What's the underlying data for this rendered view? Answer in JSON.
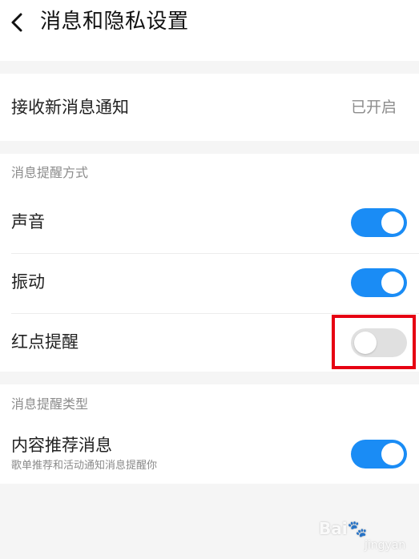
{
  "header": {
    "title": "消息和隐私设置",
    "back_icon": "chevron-left-icon"
  },
  "notification": {
    "label": "接收新消息通知",
    "value": "已开启"
  },
  "reminder_section": {
    "title": "消息提醒方式",
    "items": [
      {
        "label": "声音",
        "enabled": true
      },
      {
        "label": "振动",
        "enabled": true
      },
      {
        "label": "红点提醒",
        "enabled": false
      }
    ]
  },
  "type_section": {
    "title": "消息提醒类型",
    "items": [
      {
        "label": "内容推荐消息",
        "sublabel": "歌单推荐和活动通知消息提醒你",
        "enabled": true
      }
    ]
  },
  "highlight_color": "#e60012",
  "toggle_on_color": "#1a8cf5",
  "watermark": {
    "brand": "Bai",
    "sub": "jingyan"
  }
}
